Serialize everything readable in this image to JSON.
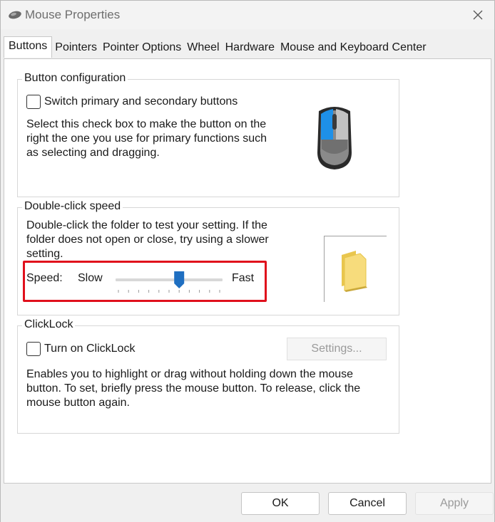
{
  "window": {
    "title": "Mouse Properties"
  },
  "tabs": [
    {
      "label": "Buttons",
      "active": true
    },
    {
      "label": "Pointers"
    },
    {
      "label": "Pointer Options"
    },
    {
      "label": "Wheel"
    },
    {
      "label": "Hardware"
    },
    {
      "label": "Mouse and Keyboard Center"
    }
  ],
  "button_config": {
    "group_label": "Button configuration",
    "checkbox_label": "Switch primary and secondary buttons",
    "checked": false,
    "description": "Select this check box to make the button on the right the one you use for primary functions such as selecting and dragging."
  },
  "double_click": {
    "group_label": "Double-click speed",
    "description": "Double-click the folder to test your setting. If the folder does not open or close, try using a slower setting.",
    "speed_label": "Speed:",
    "slow_label": "Slow",
    "fast_label": "Fast",
    "slider_value": 0.6
  },
  "clicklock": {
    "group_label": "ClickLock",
    "checkbox_label": "Turn on ClickLock",
    "checked": false,
    "settings_label": "Settings...",
    "description": "Enables you to highlight or drag without holding down the mouse button. To set, briefly press the mouse button. To release, click the mouse button again."
  },
  "footer": {
    "ok_label": "OK",
    "cancel_label": "Cancel",
    "apply_label": "Apply"
  },
  "colors": {
    "highlight": "#e0101c",
    "slider_thumb": "#1f6fc1",
    "mouse_accent": "#1e90e8"
  }
}
